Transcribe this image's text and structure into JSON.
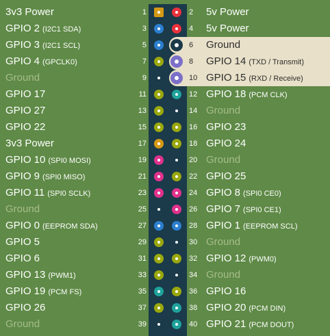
{
  "colors": {
    "power3v3": "#d69a16",
    "power5v": "#e8323c",
    "gpio": "#9aa80d",
    "i2c": "#2c7fd0",
    "uart": "#7b6fc9",
    "spi": "#e0328c",
    "pcm": "#1fa39c",
    "eeprom": "#2c7fd0",
    "ground": "#1b3a4a"
  },
  "rows": [
    {
      "left": {
        "num": "1",
        "name": "3v3 Power",
        "sub": "",
        "kind": "power3v3",
        "ground": false
      },
      "right": {
        "num": "2",
        "name": "5v Power",
        "sub": "",
        "kind": "power5v",
        "ground": false,
        "active": false
      }
    },
    {
      "left": {
        "num": "3",
        "name": "GPIO 2",
        "sub": "(I2C1 SDA)",
        "kind": "i2c",
        "ground": false
      },
      "right": {
        "num": "4",
        "name": "5v Power",
        "sub": "",
        "kind": "power5v",
        "ground": false,
        "active": false
      }
    },
    {
      "left": {
        "num": "5",
        "name": "GPIO 3",
        "sub": "(I2C1 SCL)",
        "kind": "i2c",
        "ground": false
      },
      "right": {
        "num": "6",
        "name": "Ground",
        "sub": "",
        "kind": "ground",
        "ground": true,
        "active": true
      }
    },
    {
      "left": {
        "num": "7",
        "name": "GPIO 4",
        "sub": "(GPCLK0)",
        "kind": "gpio",
        "ground": false
      },
      "right": {
        "num": "8",
        "name": "GPIO 14",
        "sub": "(TXD / Transmit)",
        "kind": "uart",
        "ground": false,
        "active": true
      }
    },
    {
      "left": {
        "num": "9",
        "name": "Ground",
        "sub": "",
        "kind": "ground",
        "ground": true
      },
      "right": {
        "num": "10",
        "name": "GPIO 15",
        "sub": "(RXD / Receive)",
        "kind": "uart",
        "ground": false,
        "active": true
      }
    },
    {
      "left": {
        "num": "11",
        "name": "GPIO 17",
        "sub": "",
        "kind": "gpio",
        "ground": false
      },
      "right": {
        "num": "12",
        "name": "GPIO 18",
        "sub": "(PCM CLK)",
        "kind": "pcm",
        "ground": false,
        "active": false
      }
    },
    {
      "left": {
        "num": "13",
        "name": "GPIO 27",
        "sub": "",
        "kind": "gpio",
        "ground": false
      },
      "right": {
        "num": "14",
        "name": "Ground",
        "sub": "",
        "kind": "ground",
        "ground": true,
        "active": false
      }
    },
    {
      "left": {
        "num": "15",
        "name": "GPIO 22",
        "sub": "",
        "kind": "gpio",
        "ground": false
      },
      "right": {
        "num": "16",
        "name": "GPIO 23",
        "sub": "",
        "kind": "gpio",
        "ground": false,
        "active": false
      }
    },
    {
      "left": {
        "num": "17",
        "name": "3v3 Power",
        "sub": "",
        "kind": "power3v3",
        "ground": false
      },
      "right": {
        "num": "18",
        "name": "GPIO 24",
        "sub": "",
        "kind": "gpio",
        "ground": false,
        "active": false
      }
    },
    {
      "left": {
        "num": "19",
        "name": "GPIO 10",
        "sub": "(SPI0 MOSI)",
        "kind": "spi",
        "ground": false
      },
      "right": {
        "num": "20",
        "name": "Ground",
        "sub": "",
        "kind": "ground",
        "ground": true,
        "active": false
      }
    },
    {
      "left": {
        "num": "21",
        "name": "GPIO 9",
        "sub": "(SPI0 MISO)",
        "kind": "spi",
        "ground": false
      },
      "right": {
        "num": "22",
        "name": "GPIO 25",
        "sub": "",
        "kind": "gpio",
        "ground": false,
        "active": false
      }
    },
    {
      "left": {
        "num": "23",
        "name": "GPIO 11",
        "sub": "(SPI0 SCLK)",
        "kind": "spi",
        "ground": false
      },
      "right": {
        "num": "24",
        "name": "GPIO 8",
        "sub": "(SPI0 CE0)",
        "kind": "spi",
        "ground": false,
        "active": false
      }
    },
    {
      "left": {
        "num": "25",
        "name": "Ground",
        "sub": "",
        "kind": "ground",
        "ground": true
      },
      "right": {
        "num": "26",
        "name": "GPIO 7",
        "sub": "(SPI0 CE1)",
        "kind": "spi",
        "ground": false,
        "active": false
      }
    },
    {
      "left": {
        "num": "27",
        "name": "GPIO 0",
        "sub": "(EEPROM SDA)",
        "kind": "eeprom",
        "ground": false
      },
      "right": {
        "num": "28",
        "name": "GPIO 1",
        "sub": "(EEPROM SCL)",
        "kind": "eeprom",
        "ground": false,
        "active": false
      }
    },
    {
      "left": {
        "num": "29",
        "name": "GPIO 5",
        "sub": "",
        "kind": "gpio",
        "ground": false
      },
      "right": {
        "num": "30",
        "name": "Ground",
        "sub": "",
        "kind": "ground",
        "ground": true,
        "active": false
      }
    },
    {
      "left": {
        "num": "31",
        "name": "GPIO 6",
        "sub": "",
        "kind": "gpio",
        "ground": false
      },
      "right": {
        "num": "32",
        "name": "GPIO 12",
        "sub": "(PWM0)",
        "kind": "gpio",
        "ground": false,
        "active": false
      }
    },
    {
      "left": {
        "num": "33",
        "name": "GPIO 13",
        "sub": "(PWM1)",
        "kind": "gpio",
        "ground": false
      },
      "right": {
        "num": "34",
        "name": "Ground",
        "sub": "",
        "kind": "ground",
        "ground": true,
        "active": false
      }
    },
    {
      "left": {
        "num": "35",
        "name": "GPIO 19",
        "sub": "(PCM FS)",
        "kind": "pcm",
        "ground": false
      },
      "right": {
        "num": "36",
        "name": "GPIO 16",
        "sub": "",
        "kind": "gpio",
        "ground": false,
        "active": false
      }
    },
    {
      "left": {
        "num": "37",
        "name": "GPIO 26",
        "sub": "",
        "kind": "gpio",
        "ground": false
      },
      "right": {
        "num": "38",
        "name": "GPIO 20",
        "sub": "(PCM DIN)",
        "kind": "pcm",
        "ground": false,
        "active": false
      }
    },
    {
      "left": {
        "num": "39",
        "name": "Ground",
        "sub": "",
        "kind": "ground",
        "ground": true
      },
      "right": {
        "num": "40",
        "name": "GPIO 21",
        "sub": "(PCM DOUT)",
        "kind": "pcm",
        "ground": false,
        "active": false
      }
    }
  ]
}
